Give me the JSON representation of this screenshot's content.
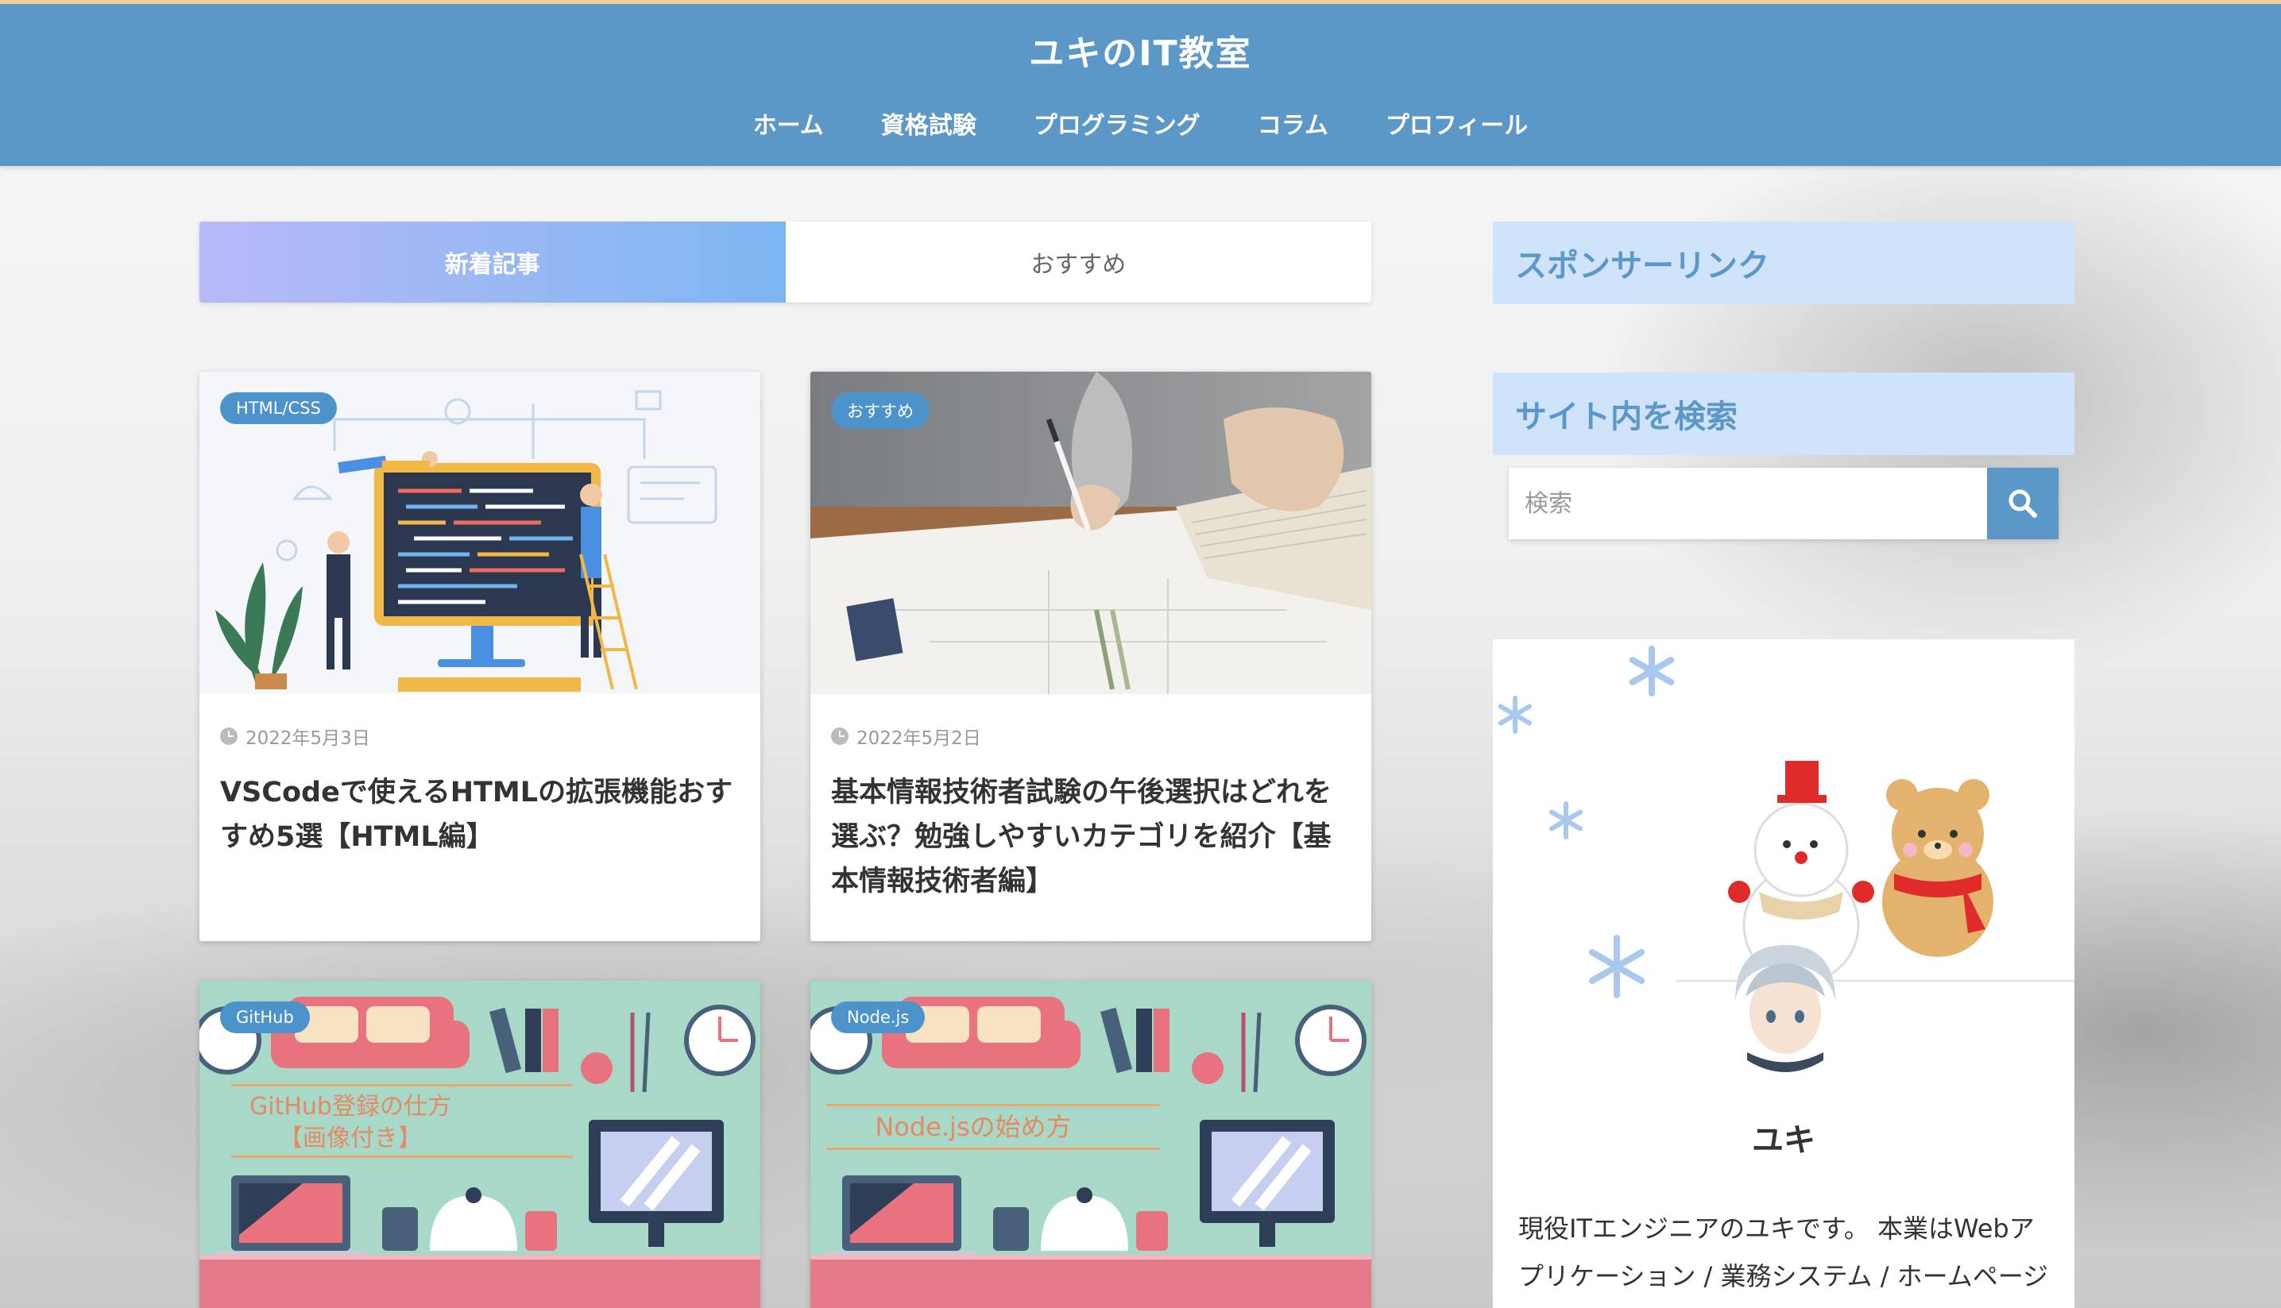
{
  "site": {
    "title": "ユキのIT教室"
  },
  "nav": [
    {
      "label": "ホーム"
    },
    {
      "label": "資格試験"
    },
    {
      "label": "プログラミング"
    },
    {
      "label": "コラム"
    },
    {
      "label": "プロフィール"
    }
  ],
  "tabs": [
    {
      "label": "新着記事",
      "active": true
    },
    {
      "label": "おすすめ",
      "active": false
    }
  ],
  "posts": [
    {
      "category": "HTML/CSS",
      "date": "2022年5月3日",
      "title": "VSCodeで使えるHTMLの拡張機能おすすめ5選【HTML編】"
    },
    {
      "category": "おすすめ",
      "date": "2022年5月2日",
      "title": "基本情報技術者試験の午後選択はどれを選ぶ？勉強しやすいカテゴリを紹介【基本情報技術者編】"
    },
    {
      "category": "GitHub",
      "thumb_text": [
        "GitHub登録の仕方",
        "【画像付き】"
      ]
    },
    {
      "category": "Node.js",
      "thumb_text": [
        "Node.jsの始め方"
      ]
    }
  ],
  "sidebar": {
    "sponsor_title": "スポンサーリンク",
    "search_title": "サイト内を検索",
    "search_placeholder": "検索",
    "profile": {
      "name": "ユキ",
      "text": "現役ITエンジニアのユキです。 本業はWebアプリケーション / 業務システム / ホームページ"
    }
  },
  "colors": {
    "header": "#5b98c8",
    "accent_badge": "#4d93cb",
    "widget_bg": "#cfe3fb"
  }
}
